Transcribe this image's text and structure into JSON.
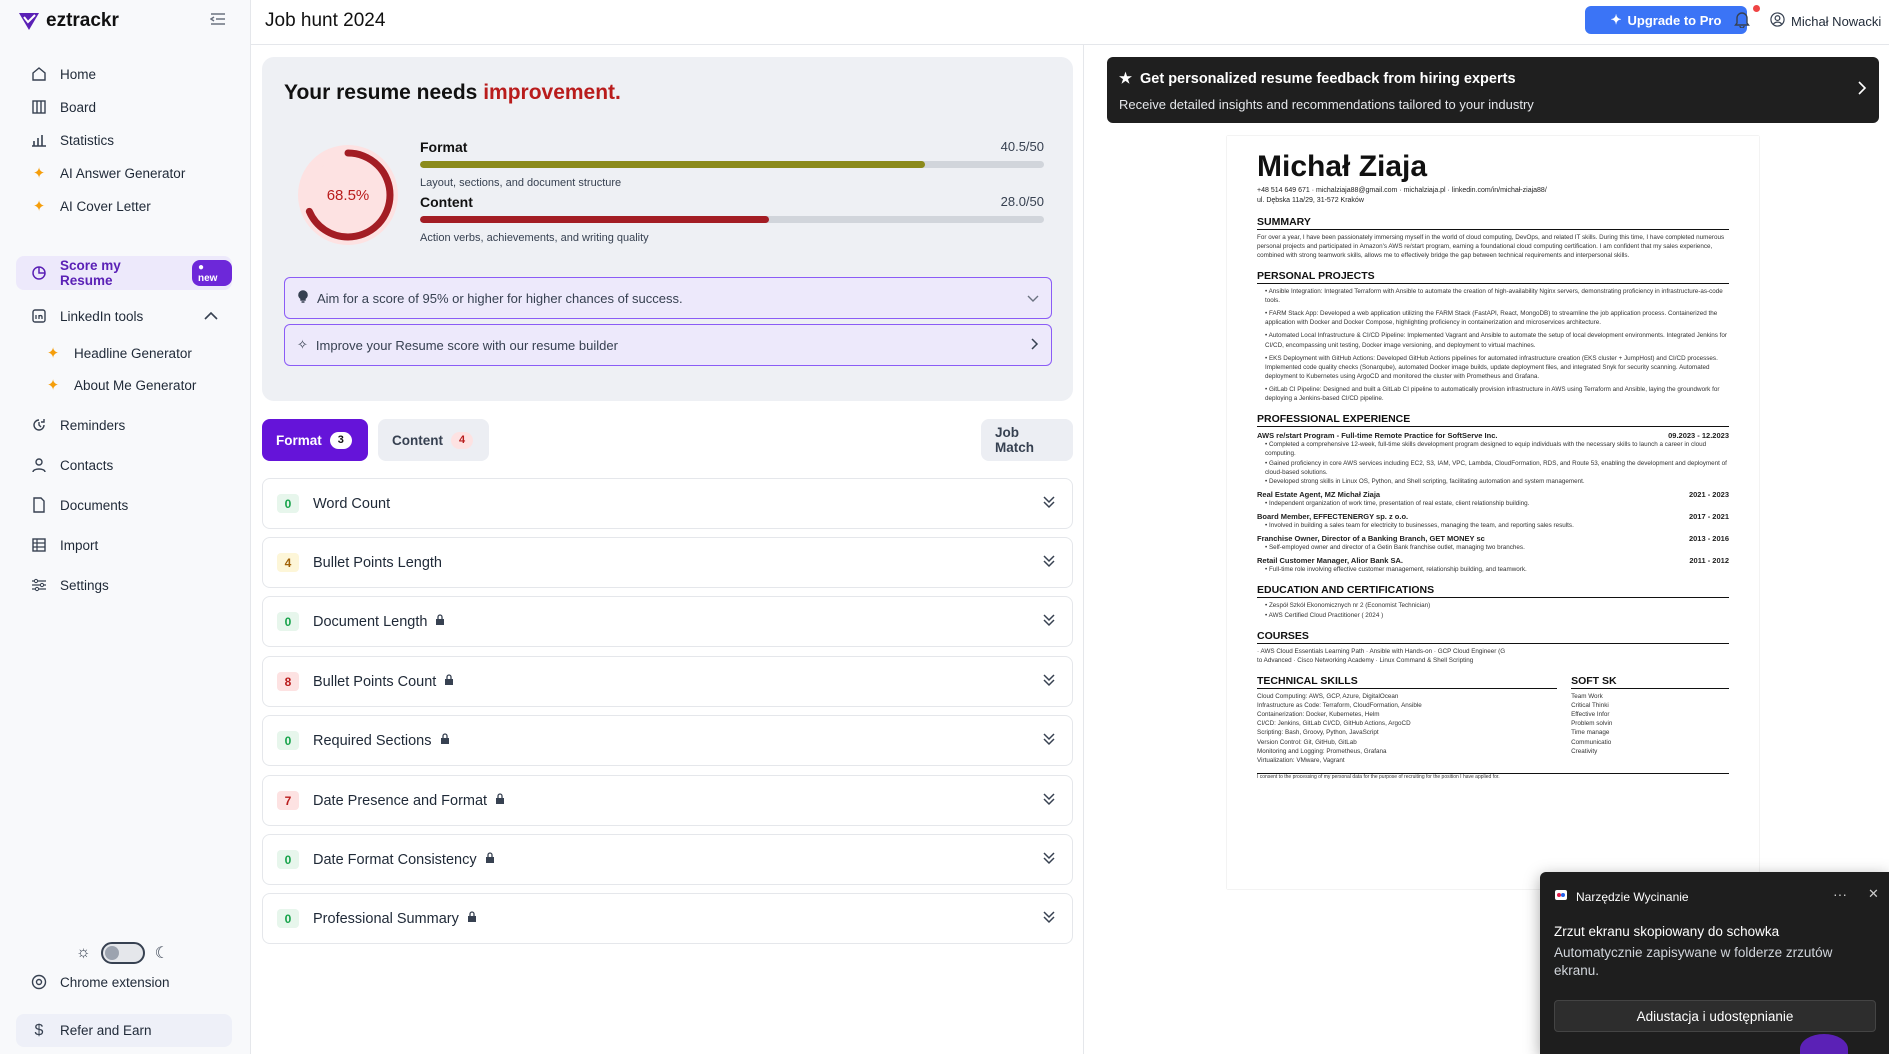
{
  "app": {
    "name": "eztrackr"
  },
  "sidebar": {
    "items": [
      {
        "label": "Home",
        "icon": "home-icon"
      },
      {
        "label": "Board",
        "icon": "board-icon"
      },
      {
        "label": "Statistics",
        "icon": "chart-icon"
      },
      {
        "label": "AI Answer Generator",
        "icon": "sparkle-icon"
      },
      {
        "label": "AI Cover Letter",
        "icon": "sparkle-icon"
      },
      {
        "label": "Score my Resume",
        "icon": "score-icon",
        "badge": "new"
      },
      {
        "label": "LinkedIn tools",
        "icon": "linkedin-icon"
      },
      {
        "label": "Headline Generator",
        "icon": "sparkle-icon"
      },
      {
        "label": "About Me Generator",
        "icon": "sparkle-icon"
      },
      {
        "label": "Reminders",
        "icon": "reminder-icon"
      },
      {
        "label": "Contacts",
        "icon": "contacts-icon"
      },
      {
        "label": "Documents",
        "icon": "document-icon"
      },
      {
        "label": "Import",
        "icon": "import-icon"
      },
      {
        "label": "Settings",
        "icon": "settings-icon"
      }
    ],
    "chrome_extension": "Chrome extension",
    "refer": "Refer and Earn"
  },
  "header": {
    "title": "Job hunt 2024",
    "upgrade": "Upgrade to Pro",
    "user": "Michał Nowacki"
  },
  "score": {
    "heading_prefix": "Your resume needs ",
    "heading_emphasis": "improvement.",
    "percent_label": "68.5%",
    "percent": 68.5,
    "metrics": [
      {
        "name": "Format",
        "value_label": "40.5/50",
        "fraction": 0.81,
        "desc": "Layout, sections, and document structure",
        "color": "#8b8a1a"
      },
      {
        "name": "Content",
        "value_label": "28.0/50",
        "fraction": 0.56,
        "desc": "Action verbs, achievements, and writing quality",
        "color": "#a31d24"
      }
    ],
    "tip": "Aim for a score of 95% or higher for higher chances of success.",
    "builder": "Improve your Resume score with our resume builder"
  },
  "tabs": {
    "format": {
      "label": "Format",
      "count": "3"
    },
    "content": {
      "label": "Content",
      "count": "4"
    },
    "job_match": "Job Match"
  },
  "checks": [
    {
      "count": "0",
      "label": "Word Count",
      "level": "green",
      "locked": false
    },
    {
      "count": "4",
      "label": "Bullet Points Length",
      "level": "yellow",
      "locked": false
    },
    {
      "count": "0",
      "label": "Document Length",
      "level": "green",
      "locked": true
    },
    {
      "count": "8",
      "label": "Bullet Points Count",
      "level": "red",
      "locked": true
    },
    {
      "count": "0",
      "label": "Required Sections",
      "level": "green",
      "locked": true
    },
    {
      "count": "7",
      "label": "Date Presence and Format",
      "level": "red",
      "locked": true
    },
    {
      "count": "0",
      "label": "Date Format Consistency",
      "level": "green",
      "locked": true
    },
    {
      "count": "0",
      "label": "Professional Summary",
      "level": "green",
      "locked": true
    }
  ],
  "promo": {
    "title": "Get personalized resume feedback from hiring experts",
    "subtitle": "Receive detailed insights and recommendations tailored to your industry"
  },
  "resume": {
    "name": "Michał Ziaja",
    "contact1": "+48 514 649 671 · michalziaja88@gmail.com · michalziaja.pl · linkedin.com/in/michał-ziaja88/",
    "contact2": "ul. Dębska 11a/29, 31-572  Kraków",
    "summary_h": "SUMMARY",
    "summary": "For over a year, I have been passionately immersing myself in the world of cloud computing, DevOps, and related IT skills. During this time, I have completed numerous personal projects and participated in Amazon's AWS re/start program, earning a foundational cloud computing certification. I am confident that my sales experience, combined with strong teamwork skills, allows me to effectively bridge the gap between technical requirements and interpersonal skills.",
    "projects_h": "PERSONAL PROJECTS",
    "projects": [
      "• Ansible Integration: Integrated Terraform with Ansible to automate the creation of high-availability Nginx servers, demonstrating proficiency in infrastructure-as-code tools.",
      "• FARM Stack App: Developed a web application utilizing the FARM Stack (FastAPI, React, MongoDB) to streamline the job application process. Containerized the application with Docker and Docker Compose, highlighting proficiency in containerization and microservices architecture.",
      "• Automated Local Infrastructure & CI/CD Pipeline: Implemented Vagrant and Ansible to automate the setup of local development environments. Integrated Jenkins for CI/CD, encompassing unit testing, Docker image versioning, and deployment to virtual machines.",
      "• EKS Deployment with GitHub Actions: Developed GitHub Actions pipelines for automated infrastructure creation (EKS cluster + JumpHost) and CI/CD processes. Implemented code quality checks (Sonarqube), automated Docker image builds, update deployment files, and integrated Snyk for security scanning. Automated deployment to Kubernetes using ArgoCD and monitored the cluster with Prometheus and Grafana.",
      "• GitLab CI Pipeline: Designed and built a GitLab CI pipeline to automatically provision infrastructure in AWS using Terraform and Ansible, laying the groundwork for deploying a Jenkins-based CI/CD pipeline."
    ],
    "experience_h": "PROFESSIONAL EXPERIENCE",
    "jobs": [
      {
        "title": "AWS re/start Program - Full-time Remote Practice for SoftServe Inc.",
        "dates": "09.2023 - 12.2023",
        "text": "• Completed a comprehensive 12-week, full-time skills development program designed to equip individuals with the necessary skills to launch a career in cloud computing.\n• Gained proficiency in core AWS services including EC2, S3, IAM, VPC, Lambda, CloudFormation, RDS, and Route 53, enabling the development and deployment of cloud-based solutions.\n• Developed strong skills in Linux OS, Python, and Shell scripting, facilitating automation and system management."
      },
      {
        "title": "Real Estate Agent, MZ Michał Ziaja",
        "dates": "2021 - 2023",
        "text": "• Independent organization of work time, presentation of real estate, client relationship building."
      },
      {
        "title": "Board Member, EFFECTENERGY sp. z o.o.",
        "dates": "2017 - 2021",
        "text": "• Involved in building a sales team for electricity to businesses, managing the team, and reporting sales results."
      },
      {
        "title": "Franchise Owner, Director of a Banking Branch, GET MONEY sc",
        "dates": "2013 - 2016",
        "text": "• Self-employed owner and director of a Getin Bank franchise outlet, managing two branches."
      },
      {
        "title": "Retail Customer Manager, Alior Bank SA.",
        "dates": "2011 - 2012",
        "text": "• Full-time role involving effective customer management, relationship building, and teamwork."
      }
    ],
    "education_h": "EDUCATION AND CERTIFICATIONS",
    "education": "• Zespół Szkół Ekonomicznych nr 2 (Economist Technician)\n• AWS Certified Cloud Practitioner ( 2024 )",
    "courses_h": "COURSES",
    "courses": "· AWS Cloud Essentials Learning Path · Ansible with Hands-on · GCP Cloud Engineer (G\nto Advanced · Cisco Networking Academy · Linux Command & Shell Scripting",
    "tech_h": "TECHNICAL SKILLS",
    "tech": "Cloud Computing: AWS, GCP, Azure, DigitalOcean\nInfrastructure as Code: Terraform, CloudFormation, Ansible\nContainerization: Docker, Kubernetes, Helm\nCI/CD: Jenkins, GitLab CI/CD, GitHub Actions, ArgoCD\nScripting: Bash, Groovy, Python, JavaScript\nVersion Control: Git, GitHub, GitLab\nMonitoring and Logging: Prometheus, Grafana\nVirtualization: VMware, Vagrant",
    "soft_h": "SOFT SK",
    "soft": "Team Work\nCritical Thinki\nEffective Infor\nProblem solvin\nTime manage\nCommunicatio\nCreativity",
    "consent": "I consent to the processing of my personal data for the purpose of recruiting for the position I have applied for."
  },
  "toast": {
    "app": "Narzędzie Wycinanie",
    "title": "Zrzut ekranu skopiowany do schowka",
    "body": "Automatycznie zapisywane w folderze zrzutów ekranu.",
    "button": "Adiustacja i udostępnianie"
  },
  "colors": {
    "accent": "#6514d9",
    "danger": "#b91c1c",
    "upgrade": "#3b74f6"
  }
}
